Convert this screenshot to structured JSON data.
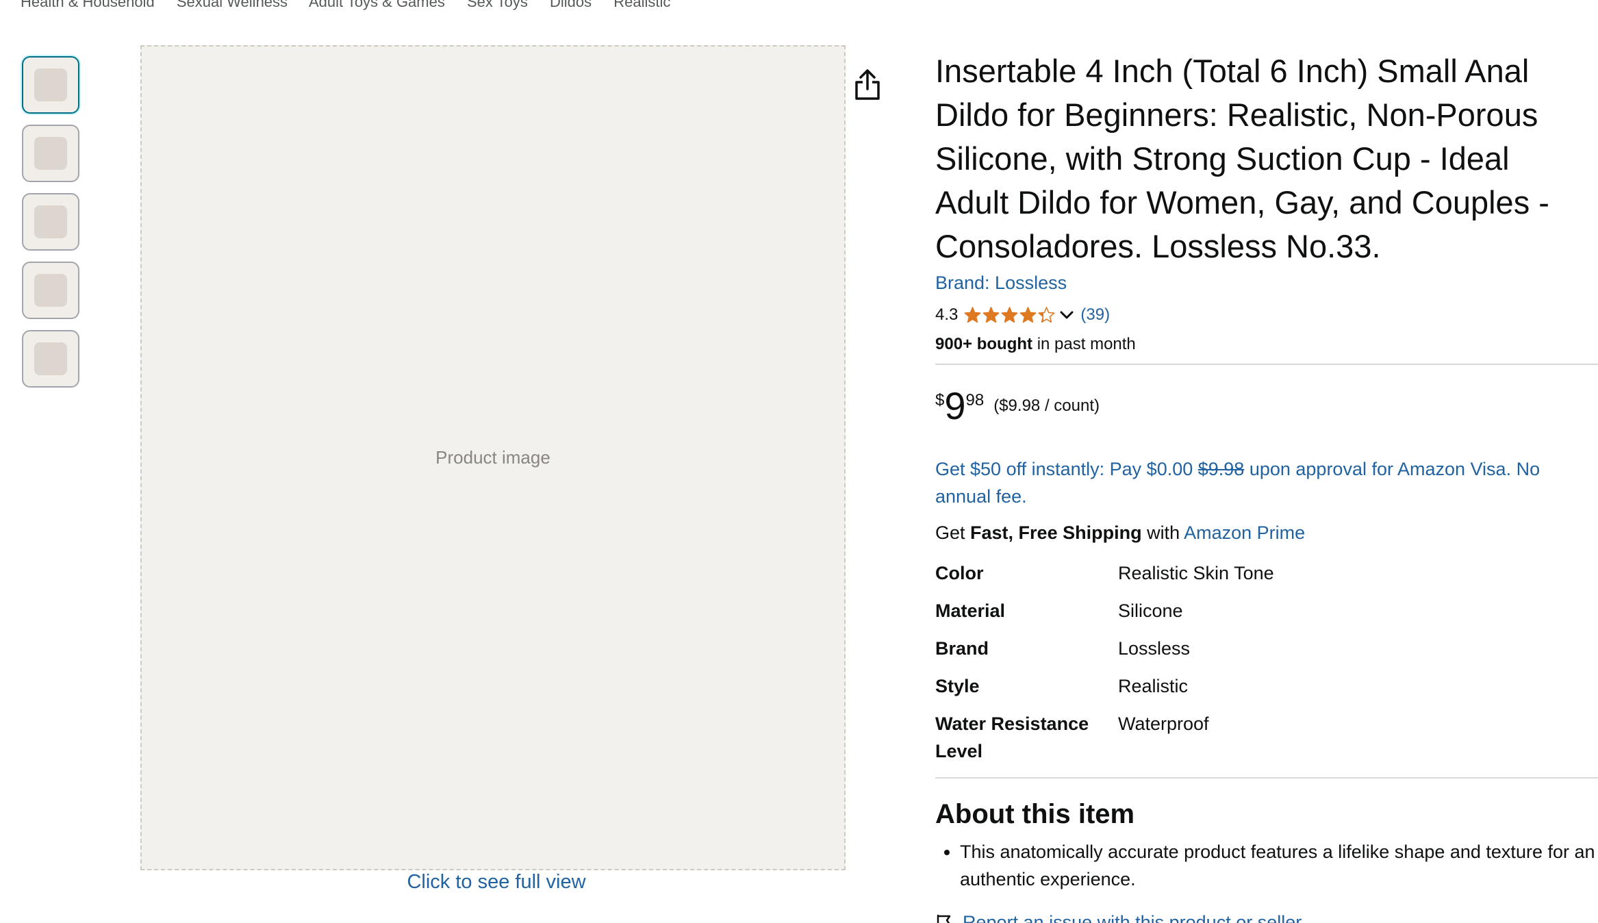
{
  "breadcrumb": [
    "Health & Household",
    "Sexual Wellness",
    "Adult Toys & Games",
    "Sex Toys",
    "Dildos",
    "Realistic"
  ],
  "gallery": {
    "thumbnail_count": 5,
    "selected_index": 0,
    "full_view_label": "Click to see full view",
    "image_placeholder": "Product image"
  },
  "product": {
    "title": "Insertable 4 Inch (Total 6 Inch) Small Anal Dildo for Beginners: Realistic, Non-Porous Silicone, with Strong Suction Cup - Ideal Adult Dildo for Women, Gay, and Couples - Consoladores. Lossless No.33.",
    "brand_link": "Brand: Lossless",
    "rating": "4.3",
    "rating_value": 4.3,
    "rating_count": "(39)",
    "bought_bold": "900+ bought",
    "bought_rest": " in past month"
  },
  "price": {
    "symbol": "$",
    "whole": "9",
    "fraction": "98",
    "unit": "($9.98 / count)"
  },
  "promo": {
    "text_before": "Get $50 off instantly: Pay $0.00 ",
    "strikethrough": "$9.98",
    "text_after": " upon approval for Amazon Visa. No annual fee."
  },
  "shipping": {
    "prefix": "Get ",
    "bold": "Fast, Free Shipping",
    "middle": " with ",
    "link": "Amazon Prime"
  },
  "specs": [
    {
      "key": "Color",
      "value": "Realistic Skin Tone"
    },
    {
      "key": "Material",
      "value": "Silicone"
    },
    {
      "key": "Brand",
      "value": "Lossless"
    },
    {
      "key": "Style",
      "value": "Realistic"
    },
    {
      "key": "Water Resistance Level",
      "value": "Waterproof"
    }
  ],
  "about": {
    "heading": "About this item",
    "bullets": [
      "This anatomically accurate product features a lifelike shape and texture for an authentic experience."
    ]
  },
  "report_link": "Report an issue with this product or seller",
  "colors": {
    "link": "#2162a1",
    "star": "#de7921",
    "text": "#0f1111",
    "divider": "#d5d9d9"
  }
}
